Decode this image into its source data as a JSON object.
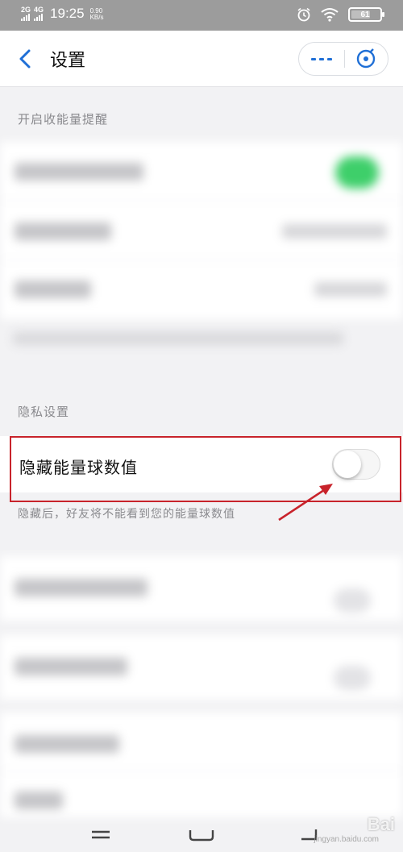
{
  "status_bar": {
    "net1": "2G",
    "net2": "4G",
    "time": "19:25",
    "speed_value": "0.90",
    "speed_unit": "KB/s",
    "battery": "61"
  },
  "header": {
    "title": "设置"
  },
  "sections": {
    "energy_title": "开启收能量提醒",
    "privacy_title": "隐私设置"
  },
  "privacy": {
    "hide_label": "隐藏能量球数值",
    "hide_toggle_on": false,
    "hide_note": "隐藏后，好友将不能看到您的能量球数值"
  },
  "watermark": {
    "text": "Bai",
    "sub": "jingyan.baidu.com"
  },
  "colors": {
    "accent_blue": "#1f6fd6",
    "highlight_red": "#c8232b",
    "toggle_green": "#3ecf6a"
  }
}
